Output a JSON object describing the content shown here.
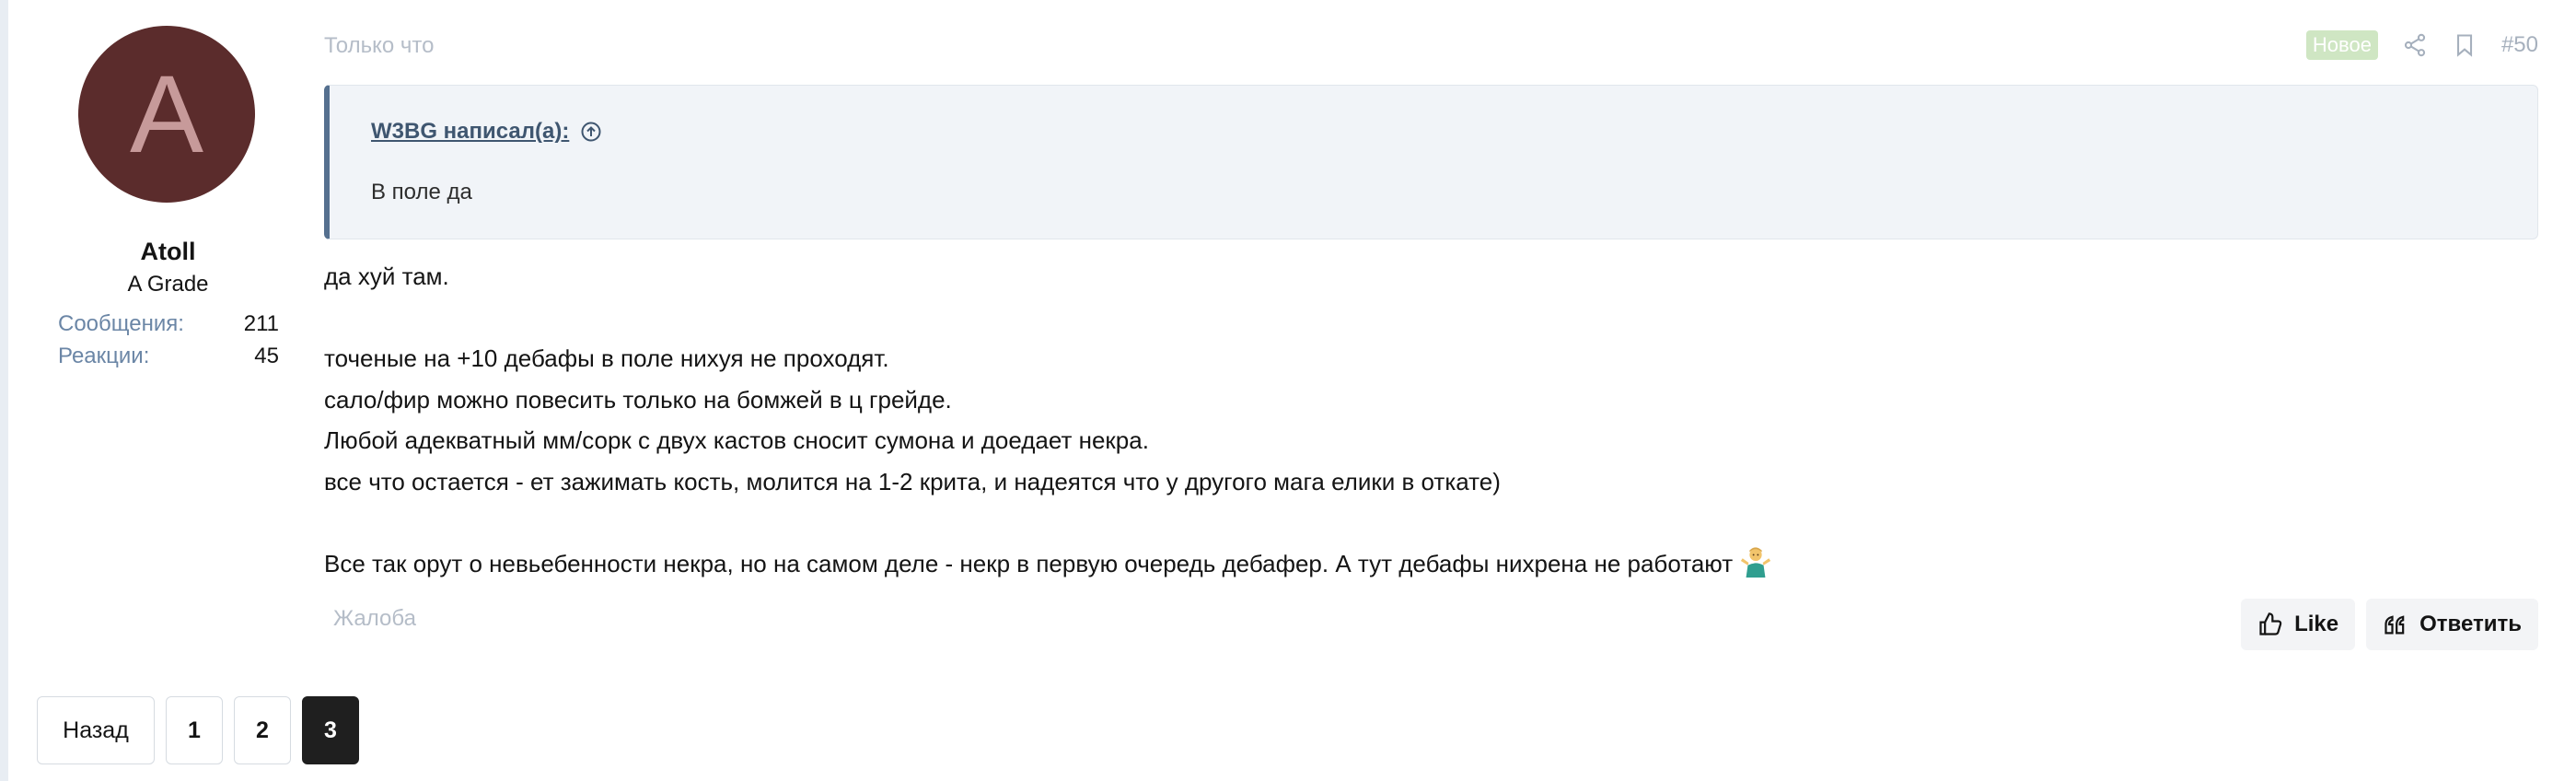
{
  "user": {
    "avatar_letter": "A",
    "avatar_bg": "#5b2c2c",
    "name": "Atoll",
    "title": "A Grade",
    "stats": [
      {
        "label": "Сообщения:",
        "value": "211"
      },
      {
        "label": "Реакции:",
        "value": "45"
      }
    ]
  },
  "post": {
    "time": "Только что",
    "badge": "Новое",
    "number": "#50",
    "quote": {
      "author": "W3BG написал(а):",
      "text": "В поле да"
    },
    "lines": [
      "да хуй там.",
      "",
      "точеные на +10 дебафы в поле нихуя не проходят.",
      "сало/фир можно повесить только на бомжей в ц грейде.",
      "Любой адекватный мм/сорк с двух кастов сносит сумона и доедает некра.",
      "все что остается - ет зажимать кость, молится на 1-2 крита, и надеятся что у другого мага елики в откате)",
      "",
      "Все так орут о невьебенности некра, но на самом деле - некр в первую очередь дебафер. А тут дебафы нихрена не работают"
    ],
    "emoji": "person-shrugging-emoji",
    "report": "Жалоба",
    "actions": {
      "like": "Like",
      "reply": "Ответить"
    }
  },
  "pagination": {
    "prev": "Назад",
    "pages": [
      "1",
      "2",
      "3"
    ],
    "current": "3"
  },
  "colors": {
    "accent": "#55708f",
    "badge": "#cfe6c3",
    "muted": "#b5bdc8",
    "link": "#6b86a6"
  }
}
